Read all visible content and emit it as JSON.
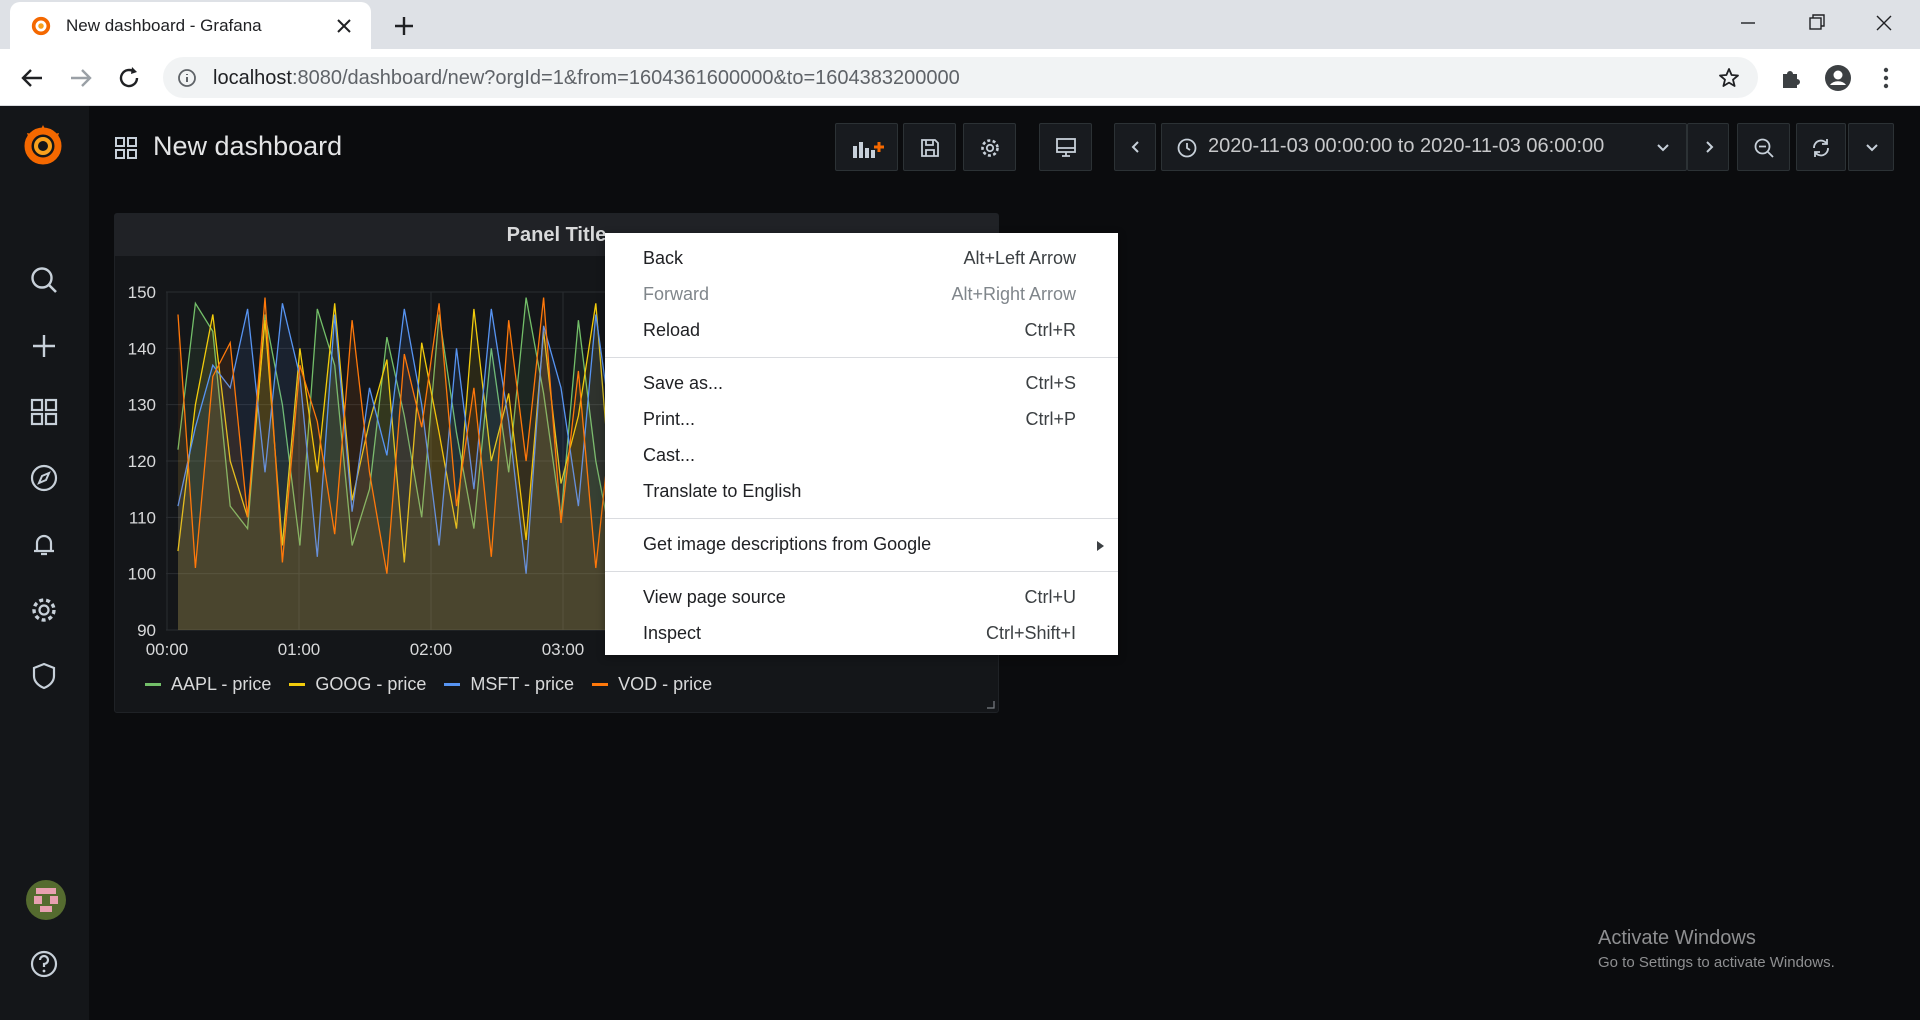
{
  "browser": {
    "tab_title": "New dashboard - Grafana",
    "url_host": "localhost",
    "url_rest": ":8080/dashboard/new?orgId=1&from=1604361600000&to=1604383200000"
  },
  "dashboard": {
    "title": "New dashboard",
    "time_range": "2020-11-03 00:00:00 to 2020-11-03 06:00:00"
  },
  "panel": {
    "title": "Panel Title"
  },
  "chart_data": {
    "type": "line",
    "title": "Panel Title",
    "x": [
      "00:00",
      "01:00",
      "02:00",
      "03:00"
    ],
    "ylim": [
      90,
      150
    ],
    "yticks": [
      "150",
      "140",
      "130",
      "120",
      "110",
      "100",
      "90"
    ],
    "grid": true,
    "legend": "bottom",
    "series": [
      {
        "name": "AAPL - price",
        "color": "#73bf69",
        "values": [
          122,
          148,
          143,
          112,
          108,
          146,
          130,
          105,
          147,
          137,
          105,
          115,
          142,
          128,
          110,
          146,
          125,
          108,
          140,
          118,
          149,
          132,
          110,
          145,
          120,
          104,
          138,
          146
        ]
      },
      {
        "name": "GOOG - price",
        "color": "#f2cc0c",
        "values": [
          104,
          130,
          146,
          120,
          110,
          145,
          105,
          140,
          118,
          148,
          113,
          127,
          138,
          102,
          141,
          125,
          108,
          147,
          120,
          132,
          106,
          143,
          116,
          128,
          148,
          110,
          135,
          121
        ]
      },
      {
        "name": "MSFT - price",
        "color": "#5794f2",
        "values": [
          112,
          126,
          137,
          133,
          147,
          118,
          148,
          135,
          103,
          146,
          111,
          133,
          121,
          147,
          130,
          105,
          140,
          115,
          147,
          127,
          100,
          144,
          133,
          112,
          146,
          124,
          140,
          118
        ]
      },
      {
        "name": "VOD - price",
        "color": "#ff780a",
        "values": [
          146,
          101,
          135,
          141,
          110,
          149,
          102,
          137,
          127,
          107,
          145,
          118,
          100,
          139,
          126,
          148,
          112,
          133,
          103,
          145,
          120,
          149,
          109,
          136,
          101,
          130,
          147,
          113
        ]
      }
    ]
  },
  "context_menu": {
    "back": "Back",
    "back_key": "Alt+Left Arrow",
    "forward": "Forward",
    "forward_key": "Alt+Right Arrow",
    "reload": "Reload",
    "reload_key": "Ctrl+R",
    "save_as": "Save as...",
    "save_as_key": "Ctrl+S",
    "print": "Print...",
    "print_key": "Ctrl+P",
    "cast": "Cast...",
    "translate": "Translate to English",
    "image_desc": "Get image descriptions from Google",
    "view_source": "View page source",
    "view_source_key": "Ctrl+U",
    "inspect": "Inspect",
    "inspect_key": "Ctrl+Shift+I"
  },
  "watermark": {
    "line1": "Activate Windows",
    "line2": "Go to Settings to activate Windows."
  }
}
